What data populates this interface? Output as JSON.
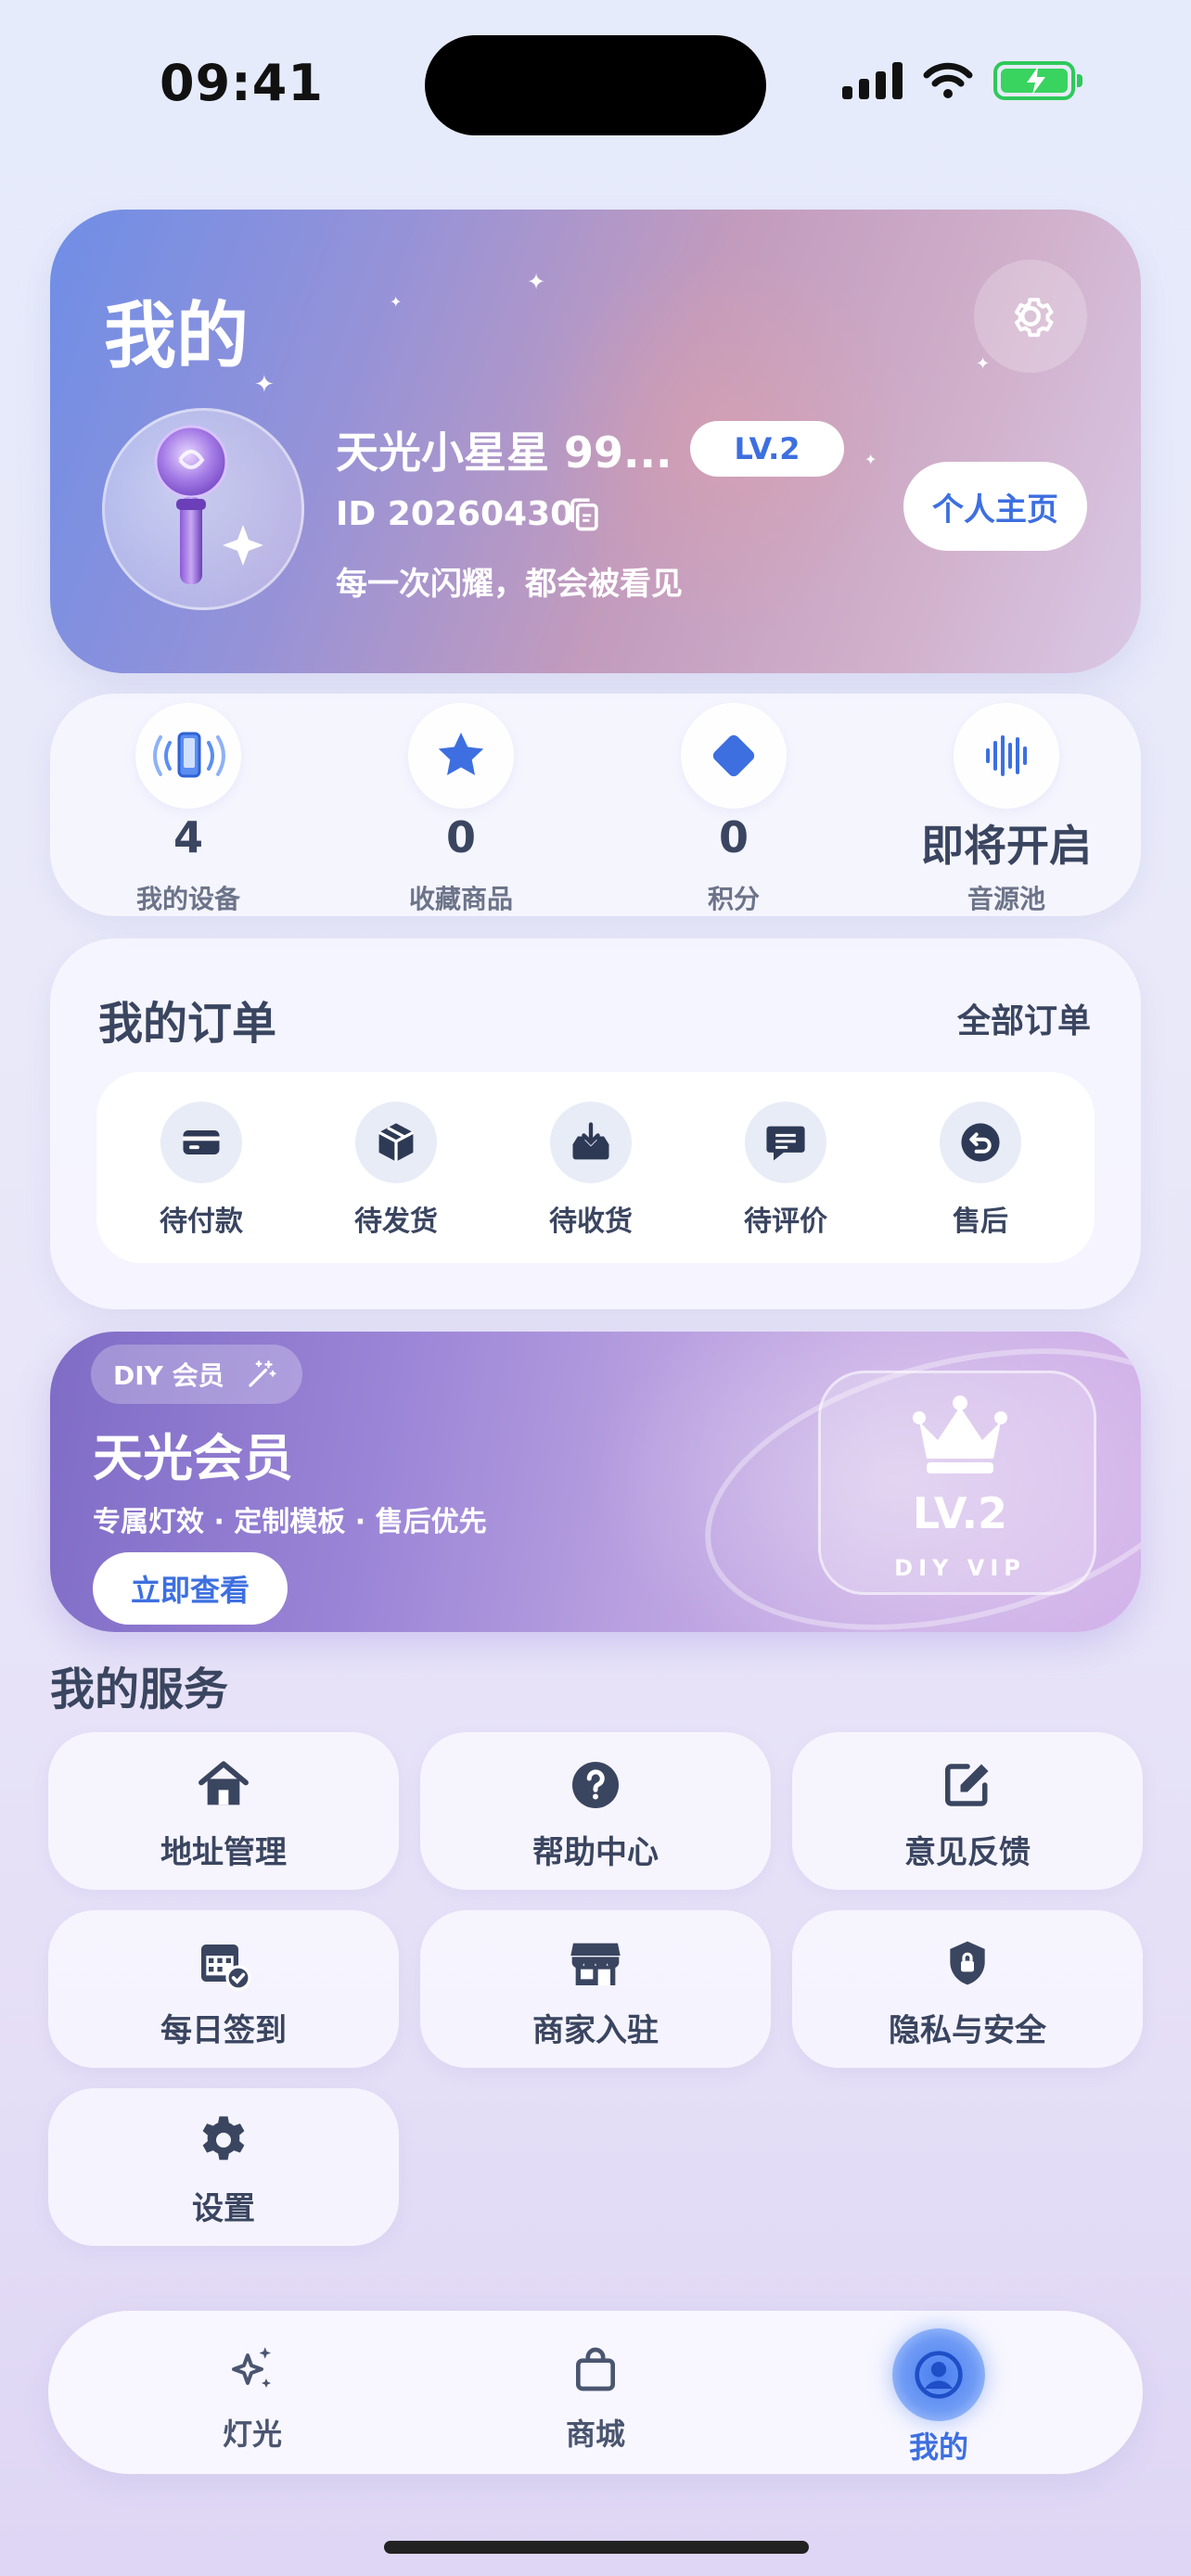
{
  "status_bar": {
    "time": "09:41"
  },
  "profile": {
    "title": "我的",
    "username": "天光小星星 99...",
    "level": "LV.2",
    "user_id": "ID 20260430",
    "motto": "每一次闪耀，都会被看见",
    "home_button": "个人主页"
  },
  "stats": [
    {
      "value": "4",
      "label": "我的设备",
      "icon": "phone-signal-icon"
    },
    {
      "value": "0",
      "label": "收藏商品",
      "icon": "star-icon"
    },
    {
      "value": "0",
      "label": "积分",
      "icon": "diamond-icon"
    },
    {
      "value": "即将开启",
      "label": "音源池",
      "icon": "sound-wave-icon"
    }
  ],
  "orders": {
    "title": "我的订单",
    "all_label": "全部订单",
    "items": [
      {
        "label": "待付款",
        "icon": "card-icon"
      },
      {
        "label": "待发货",
        "icon": "box-icon"
      },
      {
        "label": "待收货",
        "icon": "inbox-icon"
      },
      {
        "label": "待评价",
        "icon": "comment-icon"
      },
      {
        "label": "售后",
        "icon": "return-icon"
      }
    ]
  },
  "vip": {
    "tag": "DIY 会员",
    "title": "天光会员",
    "subtitle": "专属灯效 · 定制模板 · 售后优先",
    "button": "立即查看",
    "level": "LV.2",
    "badge_sub": "DIY VIP"
  },
  "services": {
    "title": "我的服务",
    "items": [
      {
        "label": "地址管理",
        "icon": "house-icon"
      },
      {
        "label": "帮助中心",
        "icon": "question-icon"
      },
      {
        "label": "意见反馈",
        "icon": "edit-icon"
      },
      {
        "label": "每日签到",
        "icon": "calendar-check-icon"
      },
      {
        "label": "商家入驻",
        "icon": "store-icon"
      },
      {
        "label": "隐私与安全",
        "icon": "shield-lock-icon"
      },
      {
        "label": "设置",
        "icon": "gear-icon"
      }
    ]
  },
  "tabbar": {
    "items": [
      {
        "label": "灯光",
        "icon": "sparkle-icon"
      },
      {
        "label": "商城",
        "icon": "shopping-bag-icon"
      },
      {
        "label": "我的",
        "icon": "user-icon",
        "active": true
      }
    ]
  },
  "colors": {
    "accent": "#3d6fe0",
    "text": "#3a4560",
    "battery": "#2ec95a"
  }
}
